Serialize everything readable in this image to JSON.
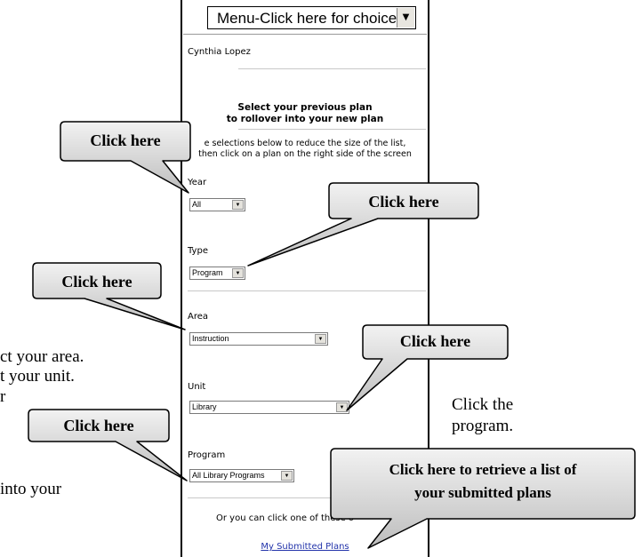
{
  "background_text": {
    "line1": "ct your area.",
    "line2": "t your unit.",
    "line3": "r",
    "line4": " into your",
    "right1": "Click the",
    "right2": "program."
  },
  "menu": {
    "label": "Menu-Click here for choices"
  },
  "user": {
    "name": "Cynthia Lopez"
  },
  "heading": {
    "line1": "Select your previous plan",
    "line2": "to rollover into your new plan"
  },
  "instructions": {
    "line1": "e selections below to reduce the size of the list,",
    "line2": "then click on a plan on the right side of the screen"
  },
  "filters": {
    "year": {
      "label": "Year",
      "value": "All"
    },
    "type": {
      "label": "Type",
      "value": "Program"
    },
    "area": {
      "label": "Area",
      "value": "Instruction"
    },
    "unit": {
      "label": "Unit",
      "value": "Library"
    },
    "program": {
      "label": "Program",
      "value": "All Library Programs"
    }
  },
  "footer": {
    "text": "Or you can click one of these o",
    "link": "My Submitted Plans"
  },
  "callouts": {
    "c1": "Click here",
    "c2": "Click here",
    "c3": "Click here",
    "c4": "Click here",
    "c5": "Click here",
    "c6_line1": "Click here to retrieve a list of",
    "c6_line2": "your submitted plans"
  }
}
